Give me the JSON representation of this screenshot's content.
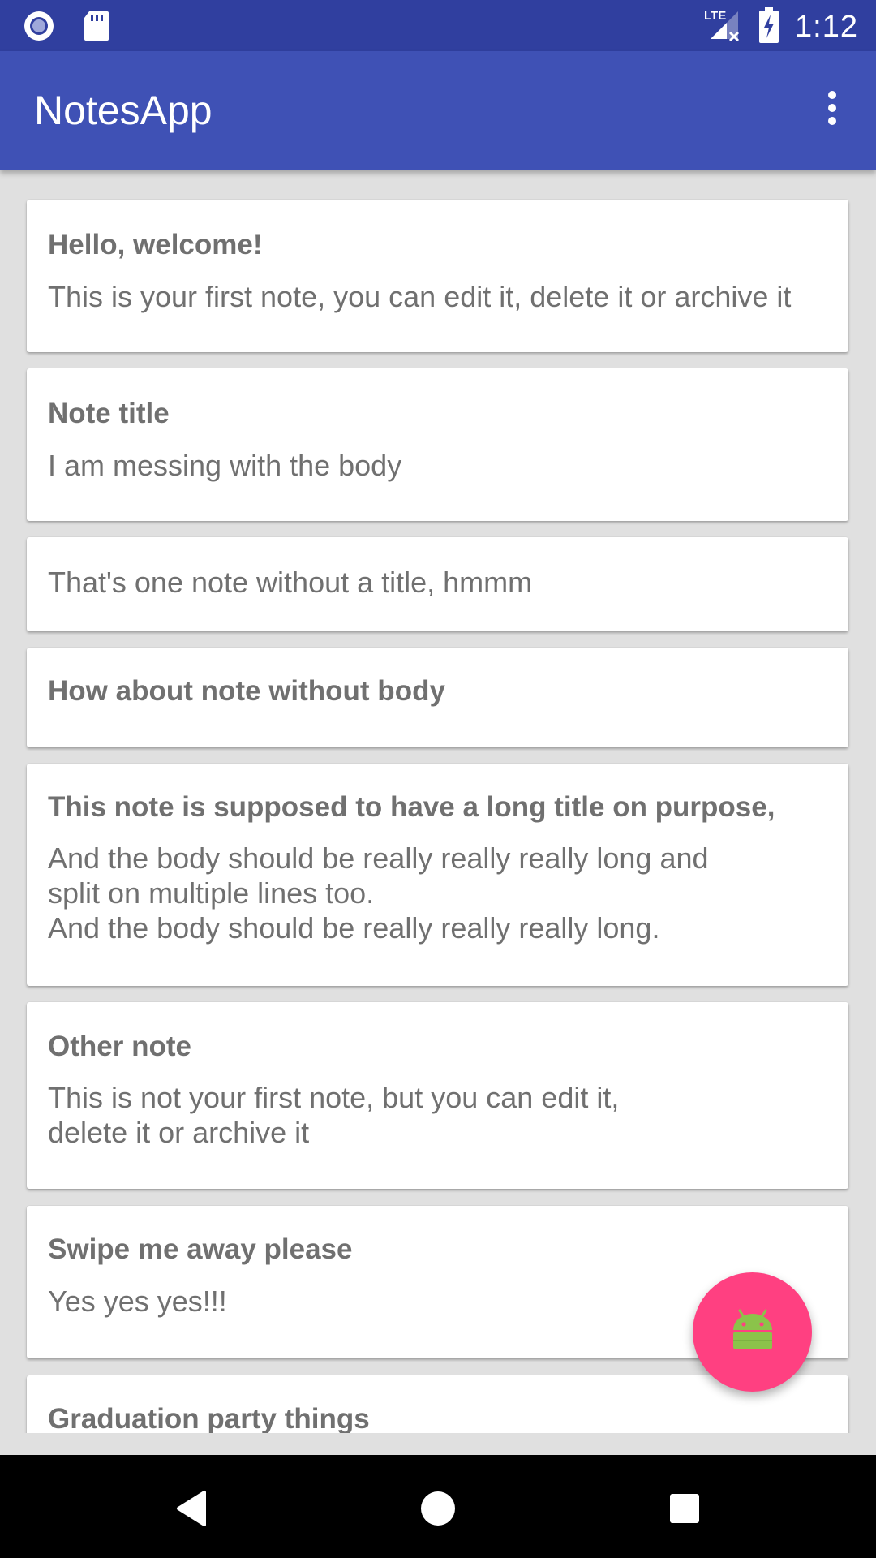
{
  "status_bar": {
    "time": "1:12",
    "icons": [
      "notification-circle-icon",
      "sd-card-icon",
      "lte-signal-icon",
      "battery-charging-icon"
    ]
  },
  "app_bar": {
    "title": "NotesApp",
    "menu_icon": "more-vert-icon",
    "background": "#3f51b5",
    "status_background": "#303f9f"
  },
  "notes": [
    {
      "title": "Hello, welcome!",
      "body": "This is your first note, you can edit it, delete it or archive it"
    },
    {
      "title": "Note title",
      "body": "I am messing with the body"
    },
    {
      "title": "",
      "body": "That's one note without a title, hmmm"
    },
    {
      "title": "How about note without body",
      "body": ""
    },
    {
      "title": "This note is supposed to have a long title on purpose,",
      "body": "And the body should be really really really long and\nsplit on multiple lines too.\nAnd the body should be really really really long."
    },
    {
      "title": "Other note",
      "body": "This is not your first note, but you can edit it,\ndelete it or archive it"
    },
    {
      "title": "Swipe me away please",
      "body": "Yes yes yes!!!"
    },
    {
      "title": "Graduation party things",
      "body": ""
    }
  ],
  "fab": {
    "icon": "android-icon",
    "color": "#ff4081",
    "icon_color": "#8bc34a"
  },
  "nav_bar": {
    "icons": [
      "back-icon",
      "home-icon",
      "recents-icon"
    ]
  }
}
